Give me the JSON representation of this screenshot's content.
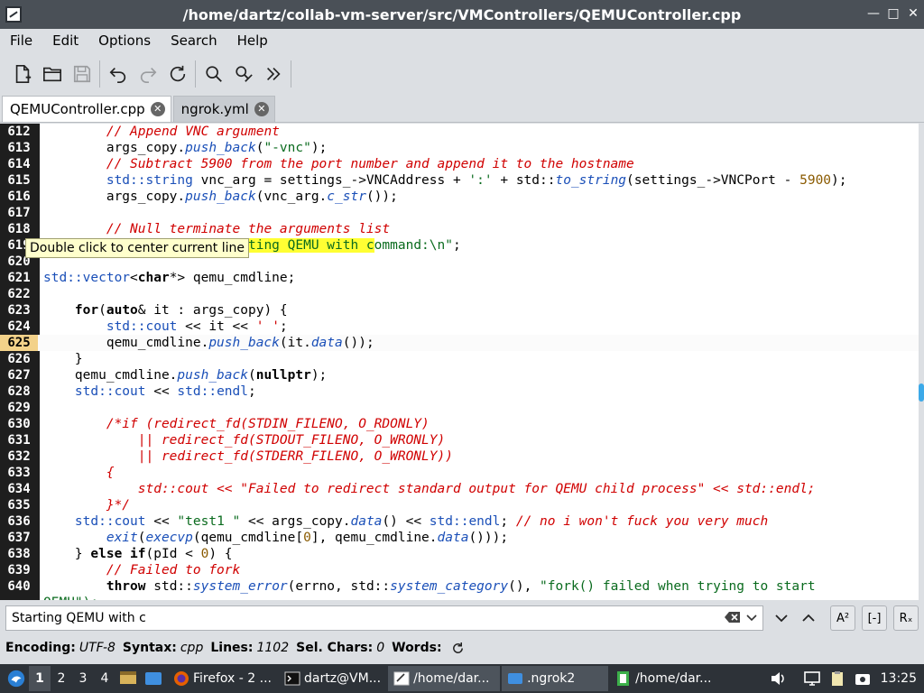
{
  "window": {
    "title": "/home/dartz/collab-vm-server/src/VMControllers/QEMUController.cpp",
    "min": "—",
    "max": "□",
    "close": "✕"
  },
  "menu": [
    "File",
    "Edit",
    "Options",
    "Search",
    "Help"
  ],
  "toolbar": [
    "new-file-icon",
    "open-folder-icon",
    "save-icon",
    "undo-icon",
    "redo-icon",
    "reload-icon",
    "find-icon",
    "find-replace-icon",
    "more-icon"
  ],
  "tabs": [
    {
      "label": "QEMUController.cpp",
      "active": true
    },
    {
      "label": "ngrok.yml",
      "active": false
    }
  ],
  "tooltip": "Double click to center current line",
  "editor": {
    "current_line": "625",
    "lines": [
      {
        "n": "612"
      },
      {
        "n": "613"
      },
      {
        "n": "614"
      },
      {
        "n": "615"
      },
      {
        "n": "616"
      },
      {
        "n": "617"
      },
      {
        "n": "618"
      },
      {
        "n": "619"
      },
      {
        "n": "620"
      },
      {
        "n": "621"
      },
      {
        "n": "622"
      },
      {
        "n": "623"
      },
      {
        "n": "624"
      },
      {
        "n": "625"
      },
      {
        "n": "626"
      },
      {
        "n": "627"
      },
      {
        "n": "628"
      },
      {
        "n": "629"
      },
      {
        "n": "630"
      },
      {
        "n": "631"
      },
      {
        "n": "632"
      },
      {
        "n": "633"
      },
      {
        "n": "634"
      },
      {
        "n": "635"
      },
      {
        "n": "636"
      },
      {
        "n": "637"
      },
      {
        "n": "638"
      },
      {
        "n": "639"
      },
      {
        "n": "640"
      }
    ]
  },
  "search": {
    "value": "Starting QEMU with c",
    "case_label": "A²",
    "whole_label": "[-]",
    "regex_label": "Rₓ"
  },
  "status": {
    "encoding_label": "Encoding:",
    "encoding": "UTF-8",
    "syntax_label": "Syntax:",
    "syntax": "cpp",
    "lines_label": "Lines:",
    "lines": "1102",
    "sel_label": "Sel. Chars:",
    "sel": "0",
    "words_label": "Words:"
  },
  "taskbar": {
    "workspaces": [
      "1",
      "2",
      "3",
      "4"
    ],
    "tasks": [
      {
        "label": "Firefox - 2 ...",
        "icon": "firefox-icon",
        "active": false
      },
      {
        "label": "dartz@VM...",
        "icon": "terminal-icon",
        "active": false
      },
      {
        "label": "/home/dar...",
        "icon": "editor-icon",
        "active": true
      },
      {
        "label": ".ngrok2",
        "icon": "folder-icon",
        "active": true
      },
      {
        "label": "/home/dar...",
        "icon": "editor-green-icon",
        "active": false
      }
    ],
    "clock": "13:25"
  },
  "colors": {
    "comment": "#d00000",
    "string": "#0a6b1e",
    "type": "#1a4fb8",
    "gutter": "#1e1e1e",
    "current_line_number": "#f3d28a",
    "search_highlight": "#ffff33",
    "taskbar": "#2d3238"
  }
}
